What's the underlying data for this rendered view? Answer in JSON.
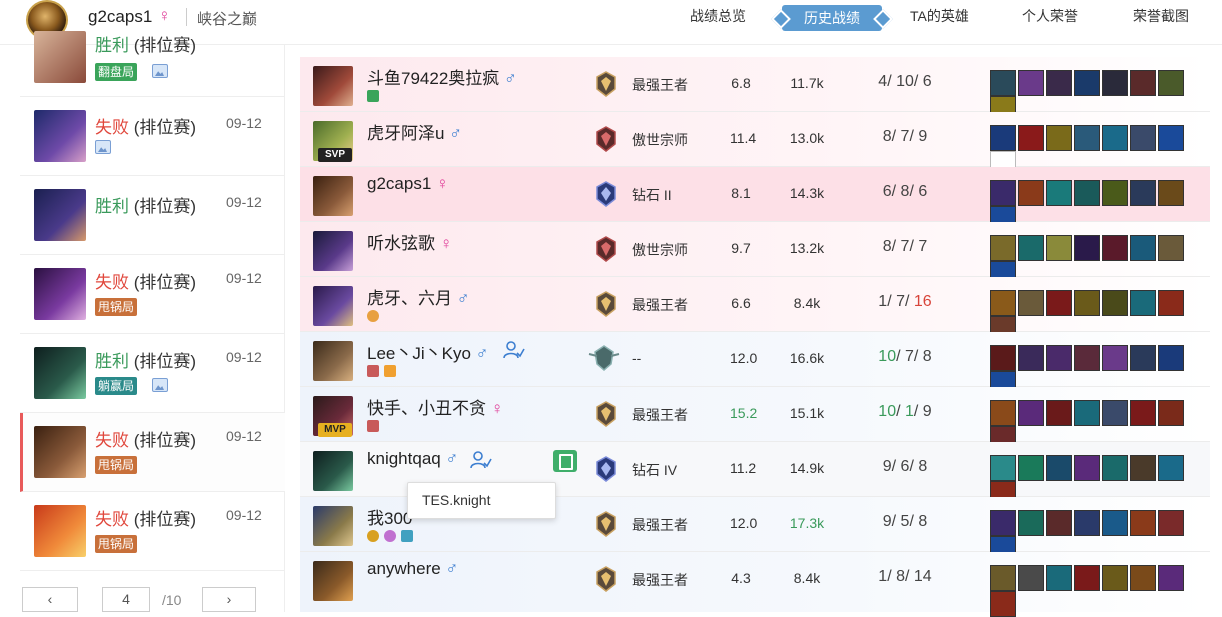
{
  "header": {
    "username": "g2caps1",
    "gender": "♀",
    "server": "峡谷之巅",
    "nav": [
      "战绩总览",
      "历史战绩",
      "TA的英雄",
      "个人荣誉",
      "荣誉截图"
    ],
    "active_index": 1
  },
  "sidebar": {
    "items": [
      {
        "result": "胜利",
        "mode": "(排位赛)",
        "date": "",
        "tag": "翻盘局",
        "has_image": true
      },
      {
        "result": "失败",
        "mode": "(排位赛)",
        "date": "09-12",
        "tag": "",
        "has_image": true
      },
      {
        "result": "胜利",
        "mode": "(排位赛)",
        "date": "09-12",
        "tag": "",
        "has_image": false
      },
      {
        "result": "失败",
        "mode": "(排位赛)",
        "date": "09-12",
        "tag": "甩锅局",
        "has_image": false
      },
      {
        "result": "胜利",
        "mode": "(排位赛)",
        "date": "09-12",
        "tag": "躺赢局",
        "has_image": true
      },
      {
        "result": "失败",
        "mode": "(排位赛)",
        "date": "09-12",
        "tag": "甩锅局",
        "has_image": false
      },
      {
        "result": "失败",
        "mode": "(排位赛)",
        "date": "09-12",
        "tag": "甩锅局",
        "has_image": false
      }
    ],
    "pager": {
      "prev": "‹",
      "current": "4",
      "total": "/10",
      "next": "›"
    }
  },
  "players": [
    {
      "name": "斗鱼79422奥拉疯",
      "gender": "♂",
      "rank": "最强王者",
      "score": "6.8",
      "damage": "11.7k",
      "k": "4",
      "d": "10",
      "a": "6",
      "badge": "",
      "style": "red"
    },
    {
      "name": "虎牙阿泽u",
      "gender": "♂",
      "rank": "傲世宗师",
      "score": "11.4",
      "damage": "13.0k",
      "k": "8",
      "d": "7",
      "a": "9",
      "badge": "SVP",
      "style": "red"
    },
    {
      "name": "g2caps1",
      "gender": "♀",
      "rank": "钻石 II",
      "score": "8.1",
      "damage": "14.3k",
      "k": "6",
      "d": "8",
      "a": "6",
      "badge": "",
      "style": "me"
    },
    {
      "name": "听水弦歌",
      "gender": "♀",
      "rank": "傲世宗师",
      "score": "9.7",
      "damage": "13.2k",
      "k": "8",
      "d": "7",
      "a": "7",
      "badge": "",
      "style": "red"
    },
    {
      "name": "虎牙、六月",
      "gender": "♂",
      "rank": "最强王者",
      "score": "6.6",
      "damage": "8.4k",
      "k": "1",
      "d": "7",
      "a": "16",
      "badge": "",
      "style": "red"
    },
    {
      "name": "Lee丶Ji丶Kyo",
      "gender": "♂",
      "rank": "--",
      "score": "12.0",
      "damage": "16.6k",
      "k": "10",
      "d": "7",
      "a": "8",
      "badge": "",
      "style": "blue"
    },
    {
      "name": "快手、小丑不贪",
      "gender": "♀",
      "rank": "最强王者",
      "score": "15.2",
      "damage": "15.1k",
      "k": "10",
      "d": "1",
      "a": "9",
      "badge": "MVP",
      "style": "blue"
    },
    {
      "name": "knightqaq",
      "gender": "♂",
      "rank": "钻石 IV",
      "score": "11.2",
      "damage": "14.9k",
      "k": "9",
      "d": "6",
      "a": "8",
      "badge": "",
      "style": "blue"
    },
    {
      "name": "我300",
      "gender": "",
      "rank": "最强王者",
      "score": "12.0",
      "damage": "17.3k",
      "k": "9",
      "d": "5",
      "a": "8",
      "badge": "",
      "style": "blue"
    },
    {
      "name": "anywhere",
      "gender": "♂",
      "rank": "最强王者",
      "score": "4.3",
      "damage": "8.4k",
      "k": "1",
      "d": "8",
      "a": "14",
      "badge": "",
      "style": "blue"
    }
  ],
  "tooltip": "TES.knight",
  "colors": {
    "accent": "#5b9bd1",
    "win": "#3a9a5b",
    "lose": "#e0473c",
    "female": "#e0409a",
    "male": "#3c7ed0"
  }
}
